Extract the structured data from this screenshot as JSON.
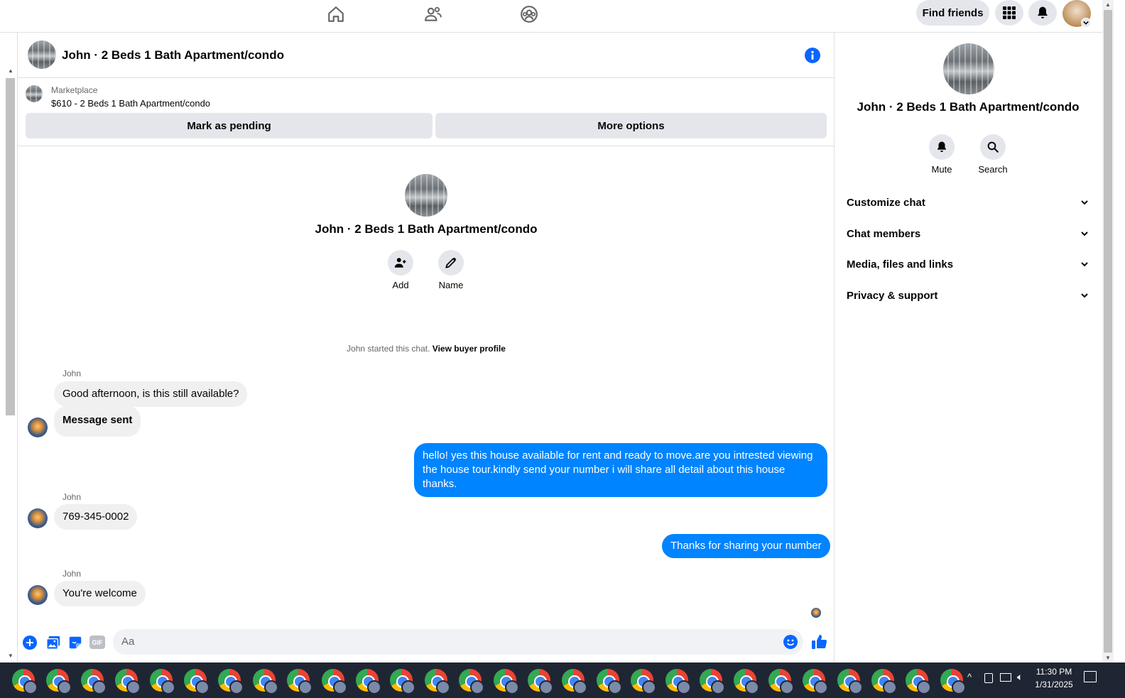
{
  "topbar": {
    "find_friends": "Find friends"
  },
  "chat": {
    "header_title": "John · 2 Beds 1 Bath Apartment/condo",
    "marketplace": {
      "label": "Marketplace",
      "listing": "$610 - 2 Beds 1 Bath Apartment/condo",
      "mark_pending": "Mark as pending",
      "more_options": "More options"
    },
    "intro": {
      "title": "John · 2 Beds 1 Bath Apartment/condo",
      "add_label": "Add",
      "name_label": "Name"
    },
    "started_text": "John started this chat.",
    "view_buyer": "View buyer profile",
    "messages": [
      {
        "sender": "John",
        "text": "Good afternoon, is this still available?"
      },
      {
        "text": "Message sent"
      },
      {
        "text": "hello! yes this house available for rent and ready to move.are you intrested viewing the house tour.kindly send your number i will share all detail about this house thanks."
      },
      {
        "sender": "John",
        "text": "769-345-0002"
      },
      {
        "text": "Thanks for sharing your number"
      },
      {
        "sender": "John",
        "text": "You're welcome"
      }
    ],
    "composer_placeholder": "Aa",
    "gif_label": "GIF"
  },
  "right_panel": {
    "title": "John · 2 Beds 1 Bath Apartment/condo",
    "mute_label": "Mute",
    "search_label": "Search",
    "sections": [
      "Customize chat",
      "Chat members",
      "Media, files and links",
      "Privacy & support"
    ]
  },
  "taskbar": {
    "time": "11:30 PM",
    "date": "1/31/2025"
  },
  "colors": {
    "accent": "#0084ff",
    "bubble_gray": "#f0f0f0",
    "button_gray": "#e4e6eb",
    "taskbar": "#1f2633"
  }
}
